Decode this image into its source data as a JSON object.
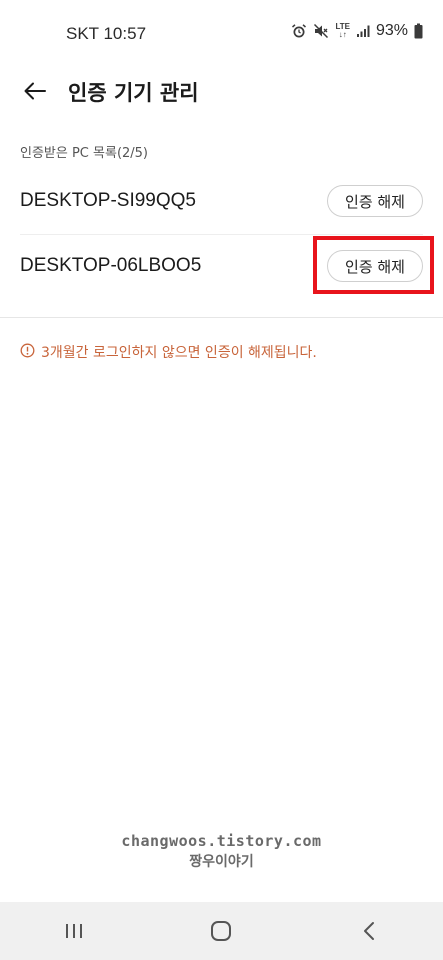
{
  "status_bar": {
    "carrier_time": "SKT 10:57",
    "lte_label": "LTE",
    "battery": "93%"
  },
  "header": {
    "title": "인증 기기 관리"
  },
  "devices_section": {
    "label": "인증받은 PC 목록(2/5)",
    "devices": [
      {
        "name": "DESKTOP-SI99QQ5",
        "action_label": "인증 해제"
      },
      {
        "name": "DESKTOP-06LBOO5",
        "action_label": "인증 해제"
      }
    ]
  },
  "notice": {
    "text": "3개월간 로그인하지 않으면 인증이 해제됩니다.",
    "color": "#c8643a"
  },
  "watermark": {
    "line1": "changwoos.tistory.com",
    "line2": "짱우이야기"
  },
  "highlight_color": "#e8141c",
  "nav_bar": {
    "items": [
      "recent-apps-icon",
      "home-icon",
      "back-icon"
    ]
  }
}
